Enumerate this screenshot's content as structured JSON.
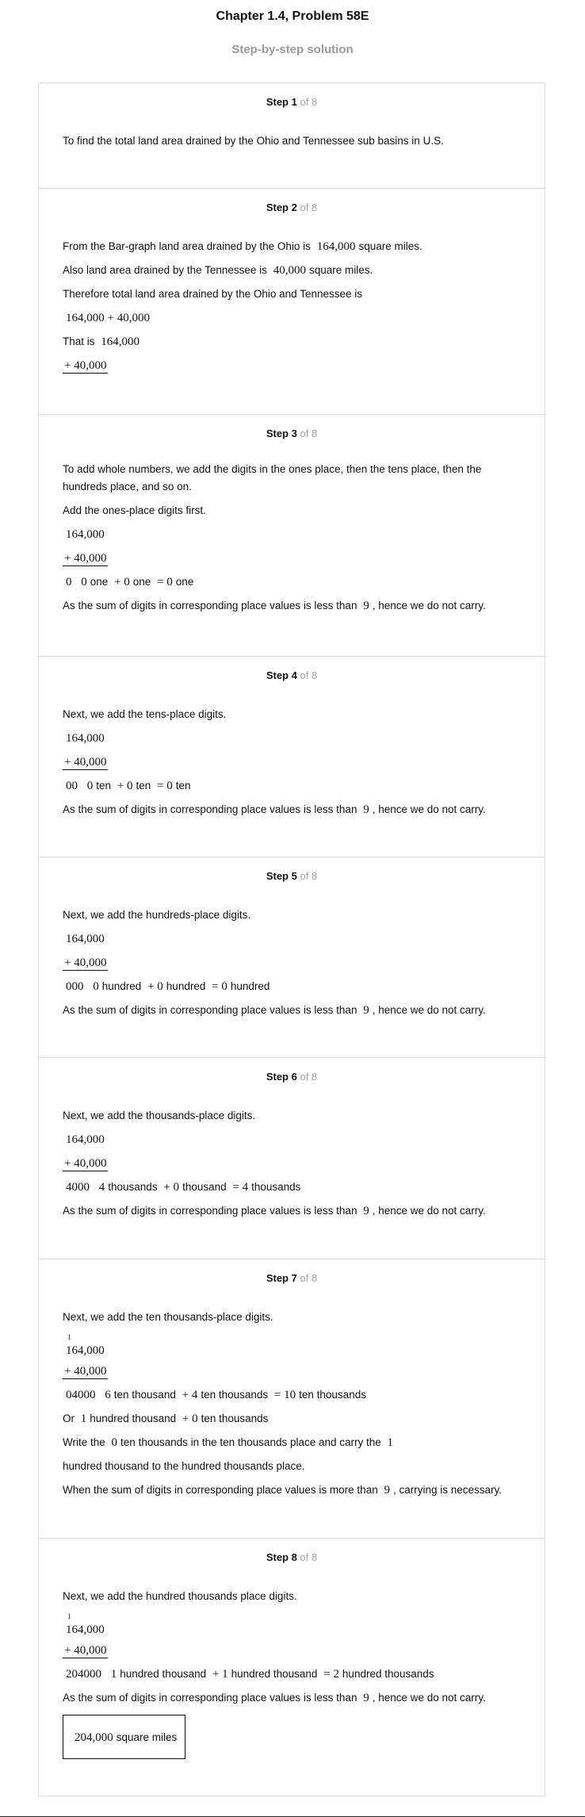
{
  "header": {
    "title": "Chapter 1.4, Problem 58E",
    "subtitle": "Step-by-step solution"
  },
  "steps": [
    {
      "label": "Step 1",
      "of": "of 8",
      "intro": "To find the total land area drained by the Ohio and Tennessee sub basins in U.S."
    },
    {
      "label": "Step 2",
      "of": "of 8",
      "l1_a": "From the Bar-graph land area drained by the Ohio is",
      "l1_m": "164,000",
      "l1_b": "square miles.",
      "l2_a": "Also land area drained by the Tennessee is",
      "l2_m": "40,000",
      "l2_b": "square miles.",
      "l3": "Therefore total land area drained by the Ohio and Tennessee is",
      "l4_m": "164,000 + 40,000",
      "l5_a": "That is",
      "l5_m": "164,000",
      "l6_m": "+ 40,000"
    },
    {
      "label": "Step 3",
      "of": "of 8",
      "l1": "To add whole numbers, we add the digits in the ones place, then the tens place, then the",
      "l2": "hundreds place, and so on.",
      "l3": "Add the ones-place digits first.",
      "top": "164,000",
      "bot": "+ 40,000",
      "sum_m": "0",
      "a_m": "0",
      "a_t": "one",
      "p1": "+ 0",
      "b_t": "one",
      "eq": "= 0",
      "c_t": "one",
      "note_a": "As the sum of digits in corresponding place values is less than",
      "note_m": "9",
      "note_b": ", hence we do not carry."
    },
    {
      "label": "Step 4",
      "of": "of 8",
      "l1": "Next, we add the tens-place digits.",
      "top": "164,000",
      "bot": "+ 40,000",
      "sum_m": "00",
      "a_m": "0",
      "a_t": "ten",
      "p1": "+ 0",
      "b_t": "ten",
      "eq": "= 0",
      "c_t": "ten",
      "note_a": "As the sum of digits in corresponding place values is less than",
      "note_m": "9",
      "note_b": ", hence we do not carry."
    },
    {
      "label": "Step 5",
      "of": "of 8",
      "l1": "Next, we add the hundreds-place digits.",
      "top": "164,000",
      "bot": "+ 40,000",
      "sum_m": "000",
      "a_m": "0",
      "a_t": "hundred",
      "p1": "+ 0",
      "b_t": "hundred",
      "eq": "= 0",
      "c_t": "hundred",
      "note_a": "As the sum of digits in corresponding place values is less than",
      "note_m": "9",
      "note_b": ", hence we do not carry."
    },
    {
      "label": "Step 6",
      "of": "of 8",
      "l1": "Next, we add the thousands-place digits.",
      "top": "164,000",
      "bot": "+ 40,000",
      "sum_m": "4000",
      "a_m": "4",
      "a_t": "thousands",
      "p1": "+ 0",
      "b_t": "thousand",
      "eq": "= 4",
      "c_t": "thousands",
      "note_a": "As the sum of digits in corresponding place values is less than",
      "note_m": "9",
      "note_b": ", hence we do not carry."
    },
    {
      "label": "Step 7",
      "of": "of 8",
      "l1": "Next, we add the ten thousands-place digits.",
      "carry": "1",
      "top": "164,000",
      "bot": "+ 40,000",
      "sum_m": "04000",
      "a_m": "6",
      "a_t": "ten thousand",
      "p1": "+ 4",
      "b_t": "ten thousands",
      "eq": "= 10",
      "c_t": "ten thousands",
      "or_a": "Or",
      "or_m1": "1",
      "or_t1": "hundred thousand",
      "or_p": "+ 0",
      "or_t2": "ten thousands",
      "w_a": "Write the",
      "w_m1": "0",
      "w_b": "ten thousands in the ten thousands place and carry the",
      "w_m2": "1",
      "w2": "hundred thousand to the hundred thousands place.",
      "note_a": "When the sum of digits in corresponding place values is more than",
      "note_m": "9",
      "note_b": ", carrying is necessary."
    },
    {
      "label": "Step 8",
      "of": "of 8",
      "l1": "Next, we add the hundred thousands place digits.",
      "carry": "1",
      "top": "164,000",
      "bot": "+ 40,000",
      "sum_m": "204000",
      "a_m": "1",
      "a_t": "hundred thousand",
      "p1": "+ 1",
      "b_t": "hundred thousand",
      "eq": "= 2",
      "c_t": "hundred thousands",
      "note_a": "As the sum of digits in corresponding place values is less than",
      "note_m": "9",
      "note_b": ", hence we do not carry.",
      "ans_m": "204,000",
      "ans_t": "square miles"
    }
  ]
}
